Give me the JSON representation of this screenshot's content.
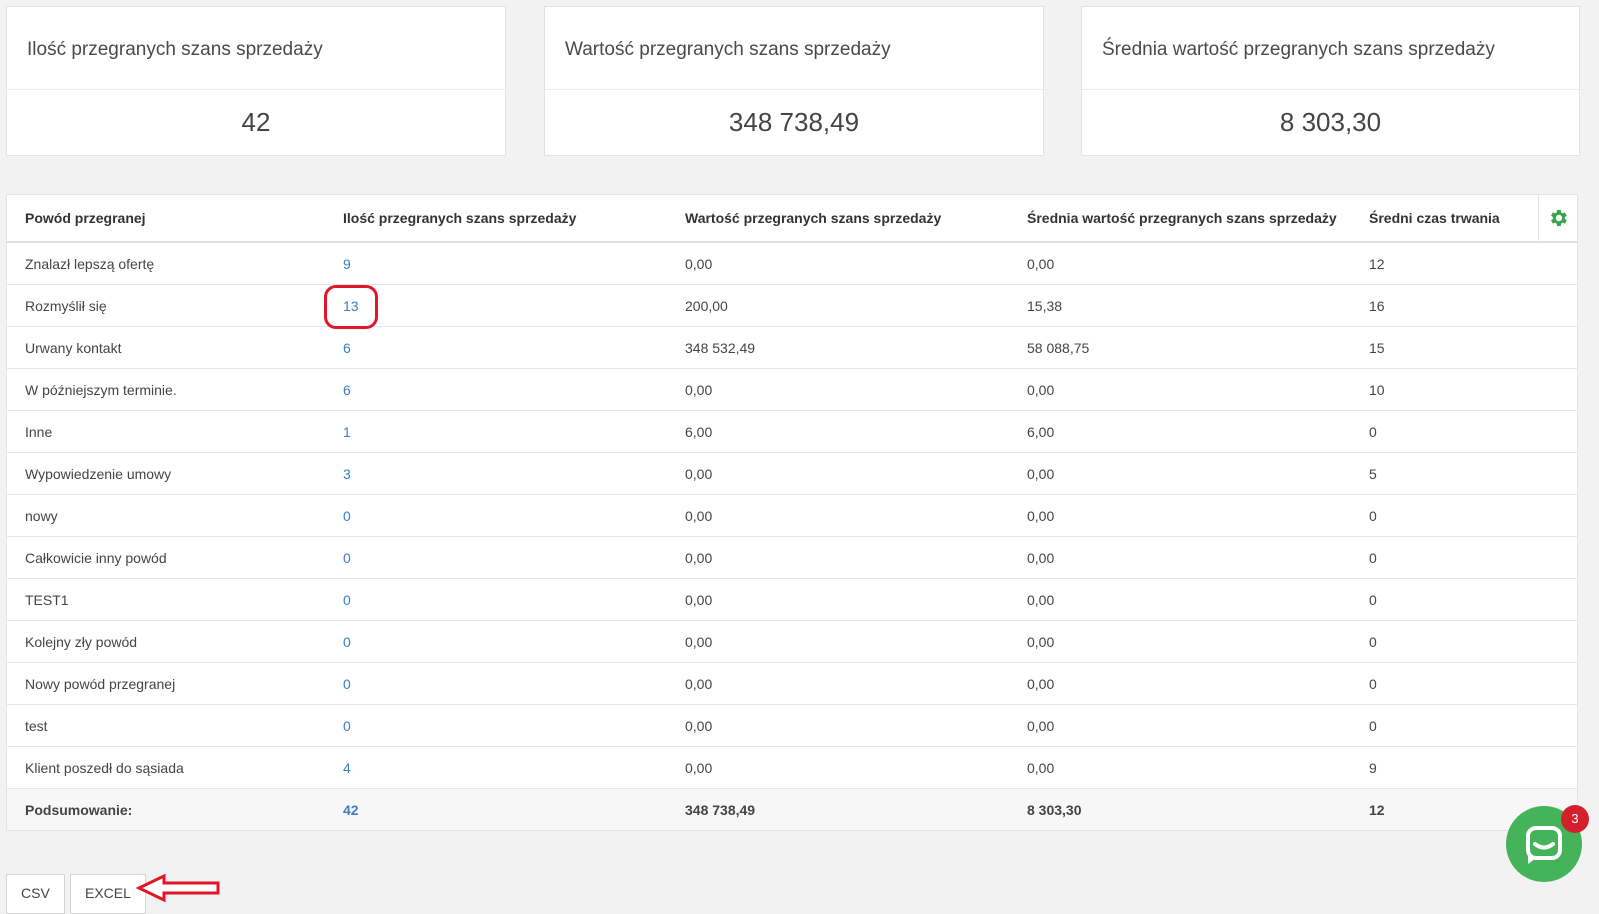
{
  "cards": [
    {
      "title": "Ilość przegranych szans sprzedaży",
      "value": "42"
    },
    {
      "title": "Wartość przegranych szans sprzedaży",
      "value": "348 738,49"
    },
    {
      "title": "Średnia wartość przegranych szans sprzedaży",
      "value": "8 303,30"
    }
  ],
  "table": {
    "headers": [
      "Powód przegranej",
      "Ilość przegranych szans sprzedaży",
      "Wartość przegranych szans sprzedaży",
      "Średnia wartość przegranych szans sprzedaży",
      "Średni czas trwania"
    ],
    "rows": [
      [
        "Znalazł lepszą ofertę",
        "9",
        "0,00",
        "0,00",
        "12"
      ],
      [
        "Rozmyślił się",
        "13",
        "200,00",
        "15,38",
        "16"
      ],
      [
        "Urwany kontakt",
        "6",
        "348 532,49",
        "58 088,75",
        "15"
      ],
      [
        "W późniejszym terminie.",
        "6",
        "0,00",
        "0,00",
        "10"
      ],
      [
        "Inne",
        "1",
        "6,00",
        "6,00",
        "0"
      ],
      [
        "Wypowiedzenie umowy",
        "3",
        "0,00",
        "0,00",
        "5"
      ],
      [
        "nowy",
        "0",
        "0,00",
        "0,00",
        "0"
      ],
      [
        "Całkowicie inny powód",
        "0",
        "0,00",
        "0,00",
        "0"
      ],
      [
        "TEST1",
        "0",
        "0,00",
        "0,00",
        "0"
      ],
      [
        "Kolejny zły powód",
        "0",
        "0,00",
        "0,00",
        "0"
      ],
      [
        "Nowy powód przegranej",
        "0",
        "0,00",
        "0,00",
        "0"
      ],
      [
        "test",
        "0",
        "0,00",
        "0,00",
        "0"
      ],
      [
        "Klient poszedł do sąsiada",
        "4",
        "0,00",
        "0,00",
        "9"
      ]
    ],
    "summary": [
      "Podsumowanie:",
      "42",
      "348 738,49",
      "8 303,30",
      "12"
    ],
    "settings_icon": "gear-icon",
    "link_color": "#3a7fc1"
  },
  "export": {
    "csv_label": "CSV",
    "excel_label": "EXCEL"
  },
  "chat": {
    "badge": "3",
    "icon": "chat-icon",
    "color": "#44b35a"
  }
}
